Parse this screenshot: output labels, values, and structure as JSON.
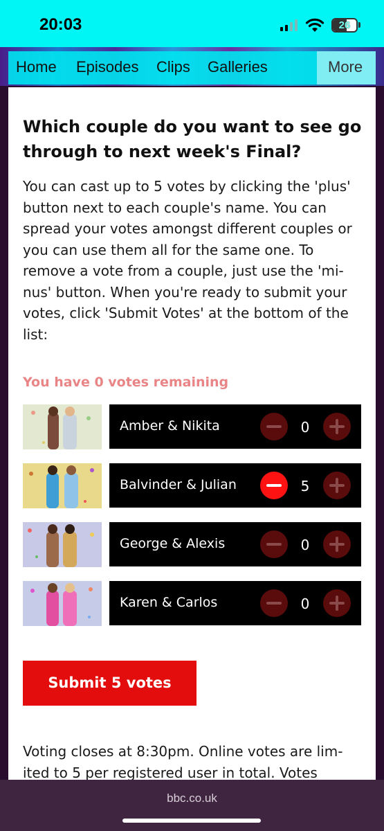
{
  "status_bar": {
    "time": "20:03",
    "battery": "26"
  },
  "nav": {
    "items": [
      "Home",
      "Episodes",
      "Clips",
      "Galleries"
    ],
    "more": "More"
  },
  "vote": {
    "heading": "Which couple do you want to see go through to next week's Final?",
    "intro": "You can cast up to 5 votes by clicking the 'plus' button next to each couple's name. You can spread your votes amongst different couples or you can use them all for the same one. To remove a vote from a couple, just use the 'mi-nus' button. When you're ready to submit your votes, click 'Submit Votes' at the bottom of the list:",
    "remaining": "You have 0 votes remaining",
    "couples": [
      {
        "name": "Amber & Nikita",
        "votes": "0"
      },
      {
        "name": "Balvinder & Julian",
        "votes": "5"
      },
      {
        "name": "George & Alexis",
        "votes": "0"
      },
      {
        "name": "Karen & Carlos",
        "votes": "0"
      }
    ],
    "submit_label": "Submit 5 votes",
    "footer": "Voting closes at 8:30pm. Online votes are lim-ited to 5 per registered user in total. Votes"
  },
  "browser": {
    "url": "bbc.co.uk"
  },
  "colors": {
    "accent": "#e30d0d",
    "remaining": "#e98586",
    "nav": "#00e6f0"
  },
  "icons": [
    "signal-icon",
    "wifi-icon",
    "battery-icon",
    "minus-icon",
    "plus-icon"
  ]
}
